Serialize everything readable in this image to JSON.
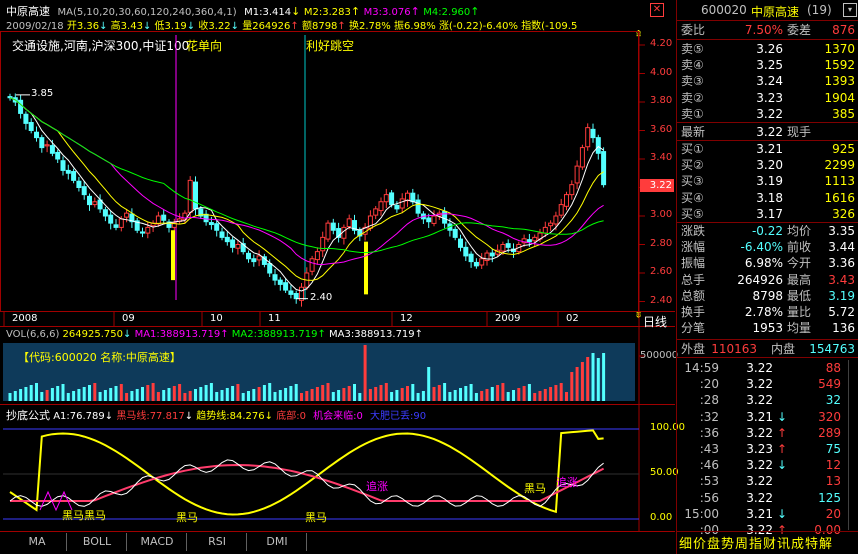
{
  "header": {
    "stock_name": "中原高速",
    "ma_line": "MA(5,10,20,30,60,120,240,360,4,1)",
    "m1": "M1:3.414",
    "m2": "M2:3.283",
    "m3": "M3:3.076",
    "m4": "M4:2.960",
    "date": "2009/02/18",
    "open": "开3.36",
    "high": "高3.43",
    "low": "低3.19",
    "close": "收3.22",
    "volume": "量264926",
    "amount": "额8798",
    "turnover": "换2.78%",
    "amplitude": "振6.98%",
    "change": "涨(-0.22)-6.40%",
    "index": "指数(-109.5"
  },
  "annotations": {
    "sector": "交通设施,河南,沪深300,中证100",
    "flower": "花单向",
    "good_news": "利好跳空",
    "high_label": "3.85",
    "low_label": "2.40",
    "price_tag": "3.22"
  },
  "price_axis": [
    "4.20",
    "4.00",
    "3.80",
    "3.60",
    "3.40",
    "3.20",
    "3.00",
    "2.80",
    "2.60",
    "2.40"
  ],
  "date_axis": [
    "2008",
    "09",
    "10",
    "11",
    "12",
    "2009",
    "02"
  ],
  "daily_button": "日线",
  "volume_panel": {
    "header": "VOL(6,6,6)",
    "value": "264925.750",
    "ma1": "MA1:388913.719",
    "ma2": "MA2:388913.719",
    "ma3": "MA3:388913.719",
    "info": "【代码:600020 名称:中原高速】",
    "axis_label": "500000"
  },
  "indicator_panel": {
    "name": "抄底公式",
    "a1": "A1:76.789",
    "black_horse": "黑马线:77.817",
    "trend": "趋势线:84.276",
    "bottom": "底部:0",
    "chance": "机会来临:0",
    "bull": "大肥已丢:90",
    "axis": [
      "100.00",
      "50.00",
      "0.00"
    ],
    "labels": [
      "黑马黑马",
      "黑马",
      "黑马",
      "追涨",
      "黑马",
      "追涨"
    ]
  },
  "tabs": [
    "MA",
    "BOLL",
    "MACD",
    "RSI",
    "DMI"
  ],
  "quote": {
    "code": "600020",
    "name": "中原高速",
    "num": "(19)",
    "weibi_label": "委比",
    "weibi": "7.50%",
    "weicha_label": "委差",
    "weicha": "876",
    "asks": [
      {
        "label": "卖⑤",
        "price": "3.26",
        "vol": "1370"
      },
      {
        "label": "卖④",
        "price": "3.25",
        "vol": "1592"
      },
      {
        "label": "卖③",
        "price": "3.24",
        "vol": "1393"
      },
      {
        "label": "卖②",
        "price": "3.23",
        "vol": "1904"
      },
      {
        "label": "卖①",
        "price": "3.22",
        "vol": "385"
      }
    ],
    "latest_label": "最新",
    "latest": "3.22",
    "hand_label": "现手",
    "bids": [
      {
        "label": "买①",
        "price": "3.21",
        "vol": "925"
      },
      {
        "label": "买②",
        "price": "3.20",
        "vol": "2299"
      },
      {
        "label": "买③",
        "price": "3.19",
        "vol": "1113"
      },
      {
        "label": "买④",
        "price": "3.18",
        "vol": "1616"
      },
      {
        "label": "买⑤",
        "price": "3.17",
        "vol": "326"
      }
    ],
    "stats": [
      {
        "l1": "涨跌",
        "v1": "-0.22",
        "l2": "均价",
        "v2": "3.35"
      },
      {
        "l1": "涨幅",
        "v1": "-6.40%",
        "l2": "前收",
        "v2": "3.44"
      },
      {
        "l1": "振幅",
        "v1": "6.98%",
        "l2": "今开",
        "v2": "3.36"
      },
      {
        "l1": "总手",
        "v1": "264926",
        "l2": "最高",
        "v2": "3.43"
      },
      {
        "l1": "总额",
        "v1": "8798",
        "l2": "最低",
        "v2": "3.19"
      },
      {
        "l1": "换手",
        "v1": "2.78%",
        "l2": "量比",
        "v2": "5.72"
      },
      {
        "l1": "分笔",
        "v1": "1953",
        "l2": "均量",
        "v2": "136"
      }
    ],
    "outer_label": "外盘",
    "outer": "110163",
    "inner_label": "内盘",
    "inner": "154763",
    "ticks": [
      {
        "time": "14:59",
        "price": "3.22",
        "arrow": "",
        "vol": "88"
      },
      {
        "time": ":20",
        "price": "3.22",
        "arrow": "",
        "vol": "549"
      },
      {
        "time": ":28",
        "price": "3.22",
        "arrow": "",
        "vol": "32"
      },
      {
        "time": ":32",
        "price": "3.21",
        "arrow": "↓",
        "vol": "320"
      },
      {
        "time": ":36",
        "price": "3.22",
        "arrow": "↑",
        "vol": "289"
      },
      {
        "time": ":43",
        "price": "3.23",
        "arrow": "↑",
        "vol": "75"
      },
      {
        "time": ":46",
        "price": "3.22",
        "arrow": "↓",
        "vol": "12"
      },
      {
        "time": ":53",
        "price": "3.22",
        "arrow": "",
        "vol": "13"
      },
      {
        "time": ":56",
        "price": "3.22",
        "arrow": "",
        "vol": "125"
      },
      {
        "time": "15:00",
        "price": "3.21",
        "arrow": "↓",
        "vol": "20"
      },
      {
        "time": ":00",
        "price": "3.22",
        "arrow": "↑",
        "vol": "0.00"
      }
    ],
    "bottom_tabs": "细价盘势周指财讯成特解"
  },
  "colors": {
    "up": "#ff3c3c",
    "down": "#54ffff",
    "yellow": "#ffff00",
    "magenta": "#ff00ff",
    "green": "#00ff00"
  },
  "chart_data": {
    "type": "candlestick",
    "title": "中原高速",
    "ylim": [
      2.35,
      4.25
    ],
    "close": [
      3.83,
      3.8,
      3.72,
      3.65,
      3.6,
      3.55,
      3.48,
      3.5,
      3.44,
      3.4,
      3.32,
      3.3,
      3.25,
      3.2,
      3.15,
      3.08,
      3.1,
      3.05,
      3.0,
      2.95,
      2.92,
      2.98,
      3.02,
      2.96,
      2.9,
      2.88,
      2.92,
      2.95,
      3.0,
      2.97,
      2.92,
      2.95,
      2.98,
      3.02,
      3.25,
      3.05,
      3.0,
      2.96,
      2.94,
      2.9,
      2.85,
      2.82,
      2.78,
      2.8,
      2.75,
      2.7,
      2.68,
      2.72,
      2.66,
      2.6,
      2.55,
      2.52,
      2.48,
      2.45,
      2.42,
      2.5,
      2.6,
      2.7,
      2.75,
      2.85,
      2.95,
      2.9,
      2.85,
      2.92,
      2.98,
      2.9,
      2.86,
      2.92,
      3.0,
      3.05,
      3.1,
      3.15,
      3.08,
      3.05,
      3.12,
      3.16,
      3.1,
      3.02,
      2.98,
      2.96,
      3.0,
      3.02,
      2.95,
      2.9,
      2.85,
      2.78,
      2.72,
      2.68,
      2.65,
      2.7,
      2.74,
      2.72,
      2.76,
      2.8,
      2.78,
      2.75,
      2.8,
      2.84,
      2.82,
      2.85,
      2.88,
      2.92,
      2.95,
      3.0,
      3.08,
      3.15,
      3.22,
      3.35,
      3.48,
      3.62,
      3.55,
      3.44,
      3.22
    ]
  }
}
